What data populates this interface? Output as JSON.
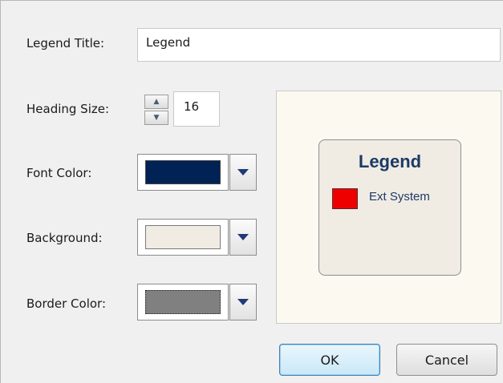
{
  "legend_title": {
    "label": "Legend Title:",
    "value": "Legend"
  },
  "heading_size": {
    "label": "Heading Size:",
    "value": "16"
  },
  "font_color": {
    "label": "Font Color:",
    "color": "#002255"
  },
  "background": {
    "label": "Background:",
    "color": "#f0ece4"
  },
  "border_color": {
    "label": "Border Color:",
    "color": "#808080"
  },
  "preview": {
    "title": "Legend",
    "item_label": "Ext System",
    "item_color": "#ee0000"
  },
  "buttons": {
    "ok": "OK",
    "cancel": "Cancel"
  },
  "icons": {
    "spin_up": "spin-up-icon",
    "spin_down": "spin-down-icon",
    "dropdown": "dropdown-arrow-icon"
  }
}
